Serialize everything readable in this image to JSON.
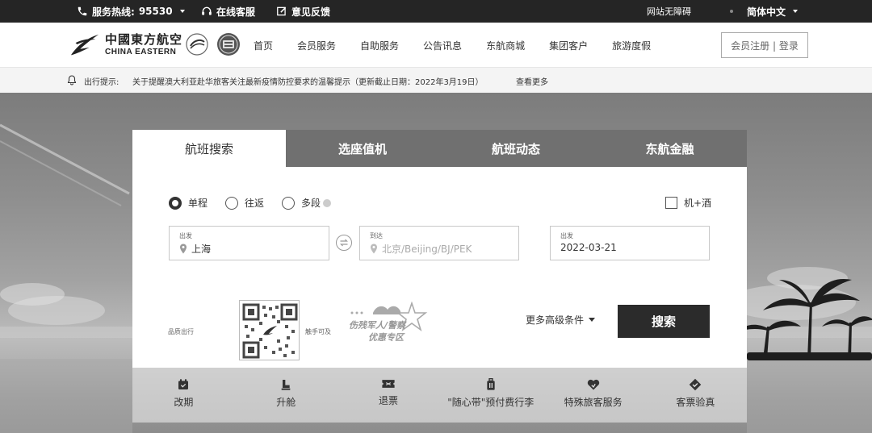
{
  "topbar": {
    "hotline_label": "服务热线:",
    "hotline_number": "95530",
    "online_service": "在线客服",
    "feedback": "意见反馈",
    "accessibility": "网站无障碍",
    "language": "简体中文"
  },
  "header": {
    "logo_cn": "中國東方航空",
    "logo_en": "CHINA EASTERN",
    "nav": [
      "首页",
      "会员服务",
      "自助服务",
      "公告讯息",
      "东航商城",
      "集团客户",
      "旅游度假"
    ],
    "login": "会员注册 | 登录"
  },
  "notice": {
    "label": "出行提示:",
    "text": "关于提醒澳大利亚赴华旅客关注最新疫情防控要求的温馨提示（更新截止日期：2022年3月19日）",
    "more": "查看更多"
  },
  "panel": {
    "tabs": [
      "航班搜索",
      "选座值机",
      "航班动态",
      "东航金融"
    ],
    "active_tab": 0,
    "trip_types": [
      "单程",
      "往返",
      "多段"
    ],
    "selected_trip": 0,
    "hotel_option": "机+酒",
    "from": {
      "label": "出发",
      "value": "上海"
    },
    "to": {
      "label": "到达",
      "placeholder": "北京/Beijing/BJ/PEK"
    },
    "date": {
      "label": "出发",
      "value": "2022-03-21"
    },
    "promo_left": "品质出行",
    "promo_right": "触手可及",
    "military_line1": "伤残军人/警察",
    "military_line2": "优惠专区",
    "advanced": "更多高级条件",
    "search": "搜索"
  },
  "quick_links": [
    {
      "label": "改期",
      "icon": "calendar-icon"
    },
    {
      "label": "升舱",
      "icon": "seat-icon"
    },
    {
      "label": "退票",
      "icon": "ticket-icon"
    },
    {
      "label": "\"随心带\"预付费行李",
      "icon": "luggage-icon"
    },
    {
      "label": "特殊旅客服务",
      "icon": "heart-hands-icon"
    },
    {
      "label": "客票验真",
      "icon": "verify-icon"
    }
  ]
}
